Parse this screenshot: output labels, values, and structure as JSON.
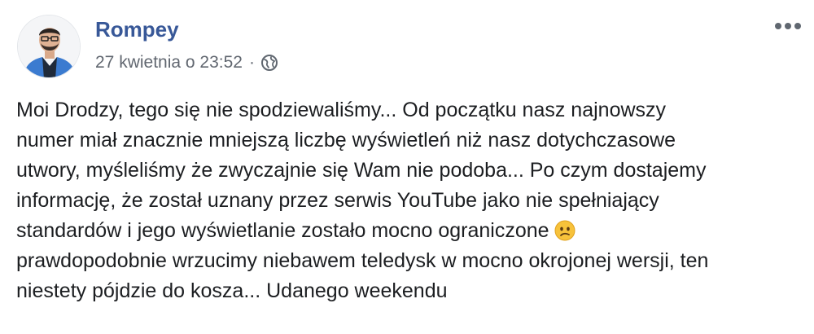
{
  "post": {
    "author": "Rompey",
    "timestamp": "27 kwietnia o 23:52",
    "separator": "·",
    "privacy_icon": "globe-icon",
    "more_icon": "more-options-icon",
    "text_lines": [
      "Moi Drodzy, tego się nie spodziewaliśmy... Od początku nasz najnowszy",
      "numer miał znacznie mniejszą liczbę wyświetleń niż nasz dotychczasowe",
      "utwory, myśleliśmy że zwyczajnie się Wam nie podoba... Po czym dostajemy",
      "informację, że został uznany przez serwis YouTube jako nie spełniający",
      "standardów i jego wyświetlanie zostało mocno ograniczone",
      "prawdopodobnie wrzucimy niebawem teledysk w mocno okrojonej wersji, ten",
      "niestety pójdzie do kosza... Udanego weekendu"
    ],
    "emoji": "confused-face-emoji"
  },
  "colors": {
    "author_link": "#385898",
    "meta_text": "#616770",
    "body_text": "#1c1e21",
    "background": "#ffffff"
  }
}
